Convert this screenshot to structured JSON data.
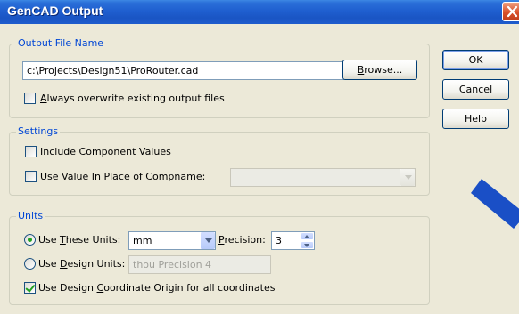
{
  "window": {
    "title": "GenCAD Output"
  },
  "output_file": {
    "group_title": "Output File Name",
    "path_value": "c:\\Projects\\Design51\\ProRouter.cad",
    "browse_label_ul": "B",
    "browse_label_rest": "rowse...",
    "overwrite_ul": "A",
    "overwrite_rest": "lways overwrite existing output files",
    "overwrite_checked": false
  },
  "settings": {
    "group_title": "Settings",
    "include_values_label": "Include Component Values",
    "include_values_checked": false,
    "use_value_label": "Use Value In Place of Compname:",
    "use_value_checked": false,
    "compname_select_value": ""
  },
  "units": {
    "group_title": "Units",
    "use_these_pre": "Use ",
    "use_these_ul": "T",
    "use_these_post": "hese Units:",
    "use_these_selected": true,
    "units_select_value": "mm",
    "precision_ul": "P",
    "precision_rest": "recision:",
    "precision_value": "3",
    "use_design_pre": "Use ",
    "use_design_ul": "D",
    "use_design_post": "esign Units:",
    "use_design_selected": false,
    "design_units_value": "thou Precision 4",
    "origin_pre": "Use Design ",
    "origin_ul": "C",
    "origin_post": "oordinate Origin for all coordinates",
    "origin_checked": true
  },
  "buttons": {
    "ok": "OK",
    "cancel": "Cancel",
    "help": "Help"
  },
  "colors": {
    "title_bar": "#1f5fd0",
    "group_title": "#0046d5",
    "check_mark": "#21a121",
    "close_button": "#d9502a",
    "background_arrow": "#1a4fc6"
  },
  "icons": {
    "close": "close-icon",
    "arrow": "arrow-decoration"
  }
}
